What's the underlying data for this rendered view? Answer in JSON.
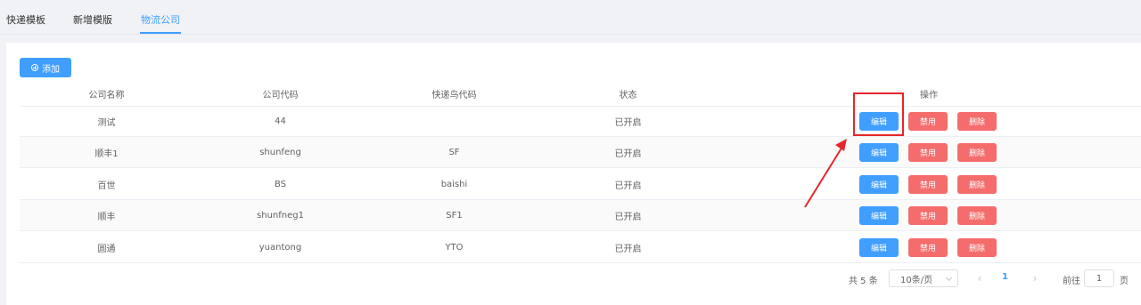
{
  "tabs": [
    {
      "label": "快递模板"
    },
    {
      "label": "新增模版"
    },
    {
      "label": "物流公司",
      "active": true
    }
  ],
  "toolbar": {
    "add_label": "添加"
  },
  "table": {
    "headers": [
      "公司名称",
      "公司代码",
      "快递鸟代码",
      "状态",
      "操作"
    ],
    "rows": [
      {
        "name": "测试",
        "code": "44",
        "kdn_code": "",
        "status": "已开启"
      },
      {
        "name": "顺丰1",
        "code": "shunfeng",
        "kdn_code": "SF",
        "status": "已开启"
      },
      {
        "name": "百世",
        "code": "BS",
        "kdn_code": "baishi",
        "status": "已开启"
      },
      {
        "name": "顺丰",
        "code": "shunfneg1",
        "kdn_code": "SF1",
        "status": "已开启"
      },
      {
        "name": "圆通",
        "code": "yuantong",
        "kdn_code": "YTO",
        "status": "已开启"
      }
    ],
    "actions": {
      "edit": "编辑",
      "disable": "禁用",
      "delete": "删除"
    }
  },
  "pagination": {
    "total_text": "共 5 条",
    "page_size": "10条/页",
    "current_page": "1",
    "goto_label": "前往",
    "goto_value": "1",
    "page_suffix": "页"
  },
  "colors": {
    "primary": "#409eff",
    "danger": "#f56c6c",
    "annotation": "#e5262a"
  }
}
